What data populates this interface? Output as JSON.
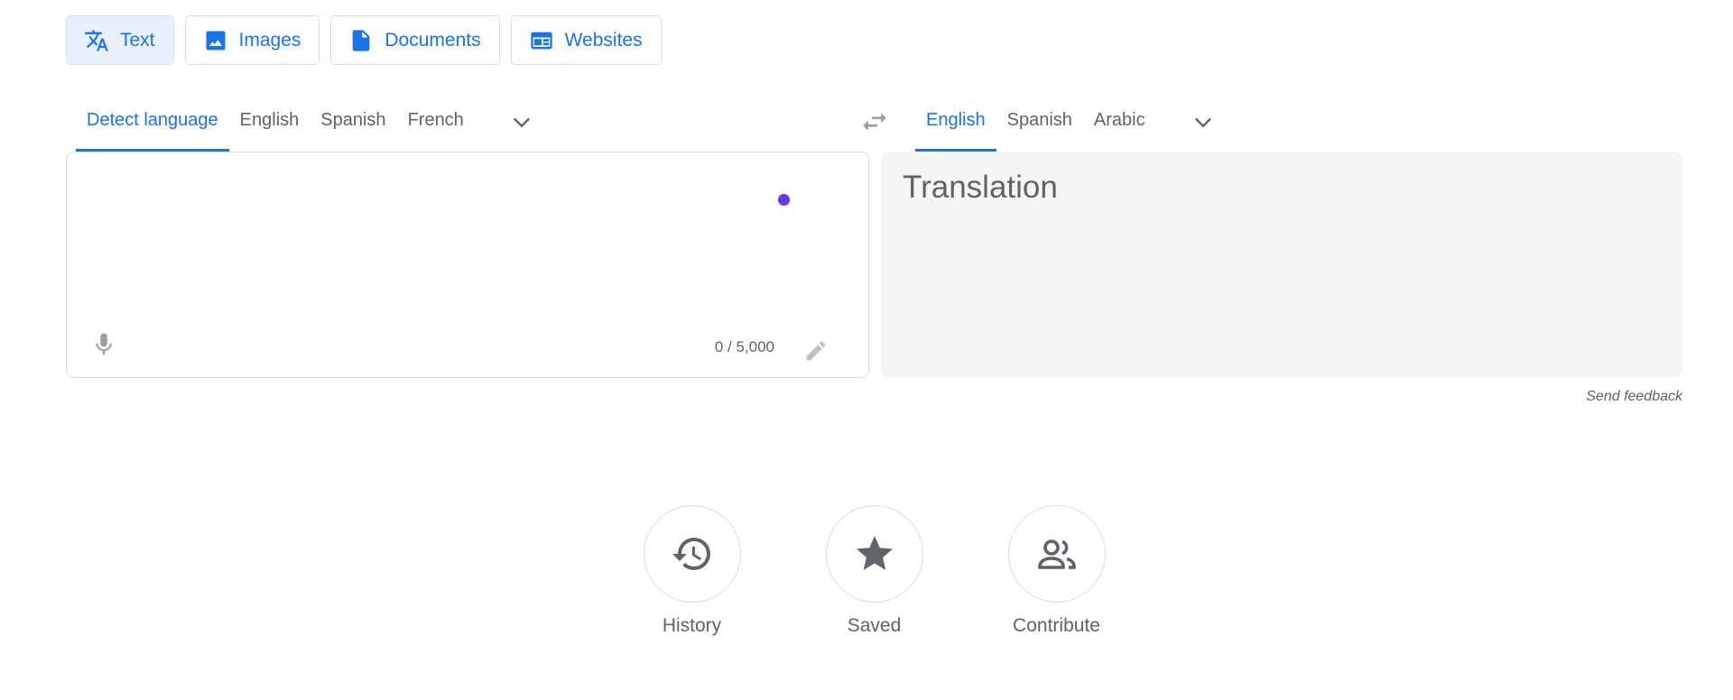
{
  "mode_tabs": [
    {
      "label": "Text",
      "icon": "translate-icon",
      "active": true
    },
    {
      "label": "Images",
      "icon": "image-icon",
      "active": false
    },
    {
      "label": "Documents",
      "icon": "document-icon",
      "active": false
    },
    {
      "label": "Websites",
      "icon": "website-icon",
      "active": false
    }
  ],
  "source_langs": [
    {
      "label": "Detect language",
      "active": true
    },
    {
      "label": "English",
      "active": false
    },
    {
      "label": "Spanish",
      "active": false
    },
    {
      "label": "French",
      "active": false
    }
  ],
  "target_langs": [
    {
      "label": "English",
      "active": true
    },
    {
      "label": "Spanish",
      "active": false
    },
    {
      "label": "Arabic",
      "active": false
    }
  ],
  "source": {
    "value": "",
    "counter": "0 / 5,000"
  },
  "target": {
    "placeholder": "Translation"
  },
  "feedback_label": "Send feedback",
  "actions": [
    {
      "label": "History",
      "icon": "history-icon"
    },
    {
      "label": "Saved",
      "icon": "star-icon"
    },
    {
      "label": "Contribute",
      "icon": "people-icon"
    }
  ],
  "colors": {
    "accent": "#1a73e8",
    "dot": "#6a36e6",
    "muted": "#5f6368"
  }
}
